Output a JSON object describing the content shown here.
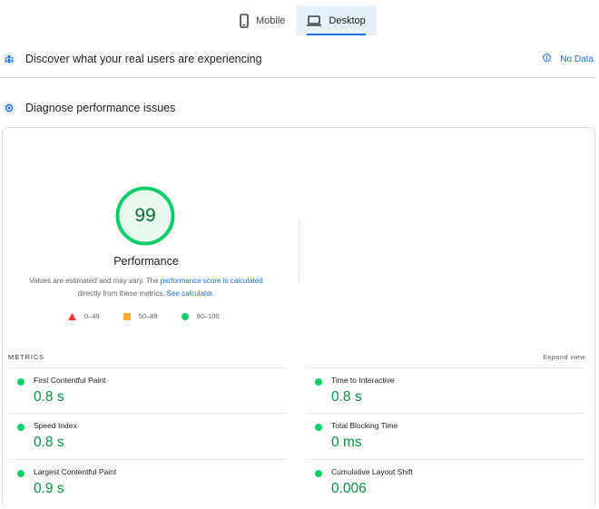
{
  "tabs": [
    {
      "label": "Mobile",
      "icon": "phone-icon",
      "active": false
    },
    {
      "label": "Desktop",
      "icon": "laptop-icon",
      "active": true
    }
  ],
  "field_data": {
    "title": "Discover what your real users are experiencing",
    "status": "No Data"
  },
  "diagnose": {
    "title": "Diagnose performance issues"
  },
  "performance": {
    "score": "99",
    "score_fraction": 0.99,
    "title": "Performance",
    "desc_part1": "Values are estimated and may vary. The ",
    "desc_link1": "performance score is calculated",
    "desc_part2": "directly from these metrics. ",
    "desc_link2": "See calculator.",
    "legend": [
      {
        "label": "0–49",
        "shape": "triangle",
        "color": "#ff3333"
      },
      {
        "label": "50–89",
        "shape": "square",
        "color": "#ffaa33"
      },
      {
        "label": "90–100",
        "shape": "circle",
        "color": "#0cce6b"
      }
    ]
  },
  "metrics": {
    "header": "METRICS",
    "expand": "Expand view",
    "items": [
      {
        "name": "First Contentful Paint",
        "value": "0.8 s"
      },
      {
        "name": "Time to Interactive",
        "value": "0.8 s"
      },
      {
        "name": "Speed Index",
        "value": "0.8 s"
      },
      {
        "name": "Total Blocking Time",
        "value": "0 ms"
      },
      {
        "name": "Largest Contentful Paint",
        "value": "0.9 s"
      },
      {
        "name": "Cumulative Layout Shift",
        "value": "0.006"
      }
    ]
  },
  "colors": {
    "accent": "#1a73e8",
    "good": "#0cce6b",
    "good_text": "#0c8f3f"
  }
}
